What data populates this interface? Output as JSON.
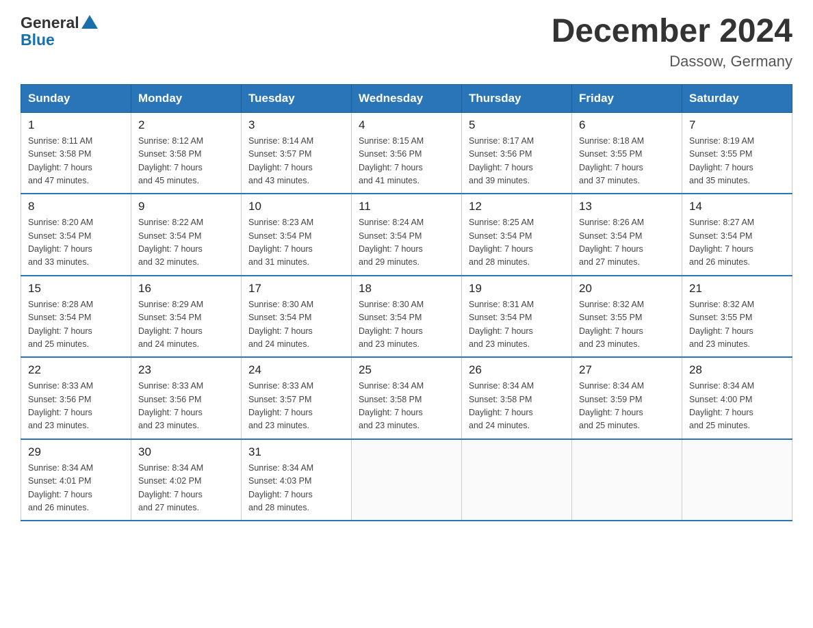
{
  "header": {
    "logo_general": "General",
    "logo_blue": "Blue",
    "title": "December 2024",
    "subtitle": "Dassow, Germany"
  },
  "days_of_week": [
    "Sunday",
    "Monday",
    "Tuesday",
    "Wednesday",
    "Thursday",
    "Friday",
    "Saturday"
  ],
  "weeks": [
    [
      {
        "day": "1",
        "info": "Sunrise: 8:11 AM\nSunset: 3:58 PM\nDaylight: 7 hours\nand 47 minutes."
      },
      {
        "day": "2",
        "info": "Sunrise: 8:12 AM\nSunset: 3:58 PM\nDaylight: 7 hours\nand 45 minutes."
      },
      {
        "day": "3",
        "info": "Sunrise: 8:14 AM\nSunset: 3:57 PM\nDaylight: 7 hours\nand 43 minutes."
      },
      {
        "day": "4",
        "info": "Sunrise: 8:15 AM\nSunset: 3:56 PM\nDaylight: 7 hours\nand 41 minutes."
      },
      {
        "day": "5",
        "info": "Sunrise: 8:17 AM\nSunset: 3:56 PM\nDaylight: 7 hours\nand 39 minutes."
      },
      {
        "day": "6",
        "info": "Sunrise: 8:18 AM\nSunset: 3:55 PM\nDaylight: 7 hours\nand 37 minutes."
      },
      {
        "day": "7",
        "info": "Sunrise: 8:19 AM\nSunset: 3:55 PM\nDaylight: 7 hours\nand 35 minutes."
      }
    ],
    [
      {
        "day": "8",
        "info": "Sunrise: 8:20 AM\nSunset: 3:54 PM\nDaylight: 7 hours\nand 33 minutes."
      },
      {
        "day": "9",
        "info": "Sunrise: 8:22 AM\nSunset: 3:54 PM\nDaylight: 7 hours\nand 32 minutes."
      },
      {
        "day": "10",
        "info": "Sunrise: 8:23 AM\nSunset: 3:54 PM\nDaylight: 7 hours\nand 31 minutes."
      },
      {
        "day": "11",
        "info": "Sunrise: 8:24 AM\nSunset: 3:54 PM\nDaylight: 7 hours\nand 29 minutes."
      },
      {
        "day": "12",
        "info": "Sunrise: 8:25 AM\nSunset: 3:54 PM\nDaylight: 7 hours\nand 28 minutes."
      },
      {
        "day": "13",
        "info": "Sunrise: 8:26 AM\nSunset: 3:54 PM\nDaylight: 7 hours\nand 27 minutes."
      },
      {
        "day": "14",
        "info": "Sunrise: 8:27 AM\nSunset: 3:54 PM\nDaylight: 7 hours\nand 26 minutes."
      }
    ],
    [
      {
        "day": "15",
        "info": "Sunrise: 8:28 AM\nSunset: 3:54 PM\nDaylight: 7 hours\nand 25 minutes."
      },
      {
        "day": "16",
        "info": "Sunrise: 8:29 AM\nSunset: 3:54 PM\nDaylight: 7 hours\nand 24 minutes."
      },
      {
        "day": "17",
        "info": "Sunrise: 8:30 AM\nSunset: 3:54 PM\nDaylight: 7 hours\nand 24 minutes."
      },
      {
        "day": "18",
        "info": "Sunrise: 8:30 AM\nSunset: 3:54 PM\nDaylight: 7 hours\nand 23 minutes."
      },
      {
        "day": "19",
        "info": "Sunrise: 8:31 AM\nSunset: 3:54 PM\nDaylight: 7 hours\nand 23 minutes."
      },
      {
        "day": "20",
        "info": "Sunrise: 8:32 AM\nSunset: 3:55 PM\nDaylight: 7 hours\nand 23 minutes."
      },
      {
        "day": "21",
        "info": "Sunrise: 8:32 AM\nSunset: 3:55 PM\nDaylight: 7 hours\nand 23 minutes."
      }
    ],
    [
      {
        "day": "22",
        "info": "Sunrise: 8:33 AM\nSunset: 3:56 PM\nDaylight: 7 hours\nand 23 minutes."
      },
      {
        "day": "23",
        "info": "Sunrise: 8:33 AM\nSunset: 3:56 PM\nDaylight: 7 hours\nand 23 minutes."
      },
      {
        "day": "24",
        "info": "Sunrise: 8:33 AM\nSunset: 3:57 PM\nDaylight: 7 hours\nand 23 minutes."
      },
      {
        "day": "25",
        "info": "Sunrise: 8:34 AM\nSunset: 3:58 PM\nDaylight: 7 hours\nand 23 minutes."
      },
      {
        "day": "26",
        "info": "Sunrise: 8:34 AM\nSunset: 3:58 PM\nDaylight: 7 hours\nand 24 minutes."
      },
      {
        "day": "27",
        "info": "Sunrise: 8:34 AM\nSunset: 3:59 PM\nDaylight: 7 hours\nand 25 minutes."
      },
      {
        "day": "28",
        "info": "Sunrise: 8:34 AM\nSunset: 4:00 PM\nDaylight: 7 hours\nand 25 minutes."
      }
    ],
    [
      {
        "day": "29",
        "info": "Sunrise: 8:34 AM\nSunset: 4:01 PM\nDaylight: 7 hours\nand 26 minutes."
      },
      {
        "day": "30",
        "info": "Sunrise: 8:34 AM\nSunset: 4:02 PM\nDaylight: 7 hours\nand 27 minutes."
      },
      {
        "day": "31",
        "info": "Sunrise: 8:34 AM\nSunset: 4:03 PM\nDaylight: 7 hours\nand 28 minutes."
      },
      {
        "day": "",
        "info": ""
      },
      {
        "day": "",
        "info": ""
      },
      {
        "day": "",
        "info": ""
      },
      {
        "day": "",
        "info": ""
      }
    ]
  ]
}
